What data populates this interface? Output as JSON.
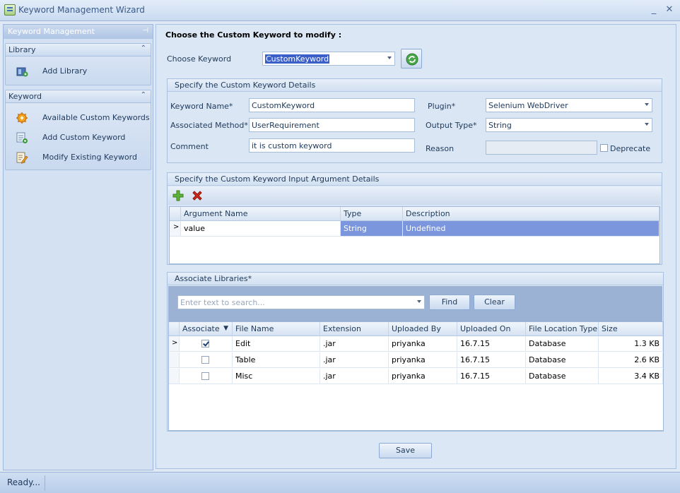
{
  "window": {
    "title": "Keyword Management Wizard",
    "minimize_glyph": "_",
    "close_glyph": "✕"
  },
  "left_pane": {
    "header": "Keyword Management",
    "pin_glyph": "⊣",
    "groups": [
      {
        "title": "Library",
        "items": [
          {
            "label": "Add Library",
            "icon": "add-library-icon"
          }
        ]
      },
      {
        "title": "Keyword",
        "items": [
          {
            "label": "Available Custom Keywords",
            "icon": "gear-icon"
          },
          {
            "label": "Add Custom Keyword",
            "icon": "add-keyword-icon"
          },
          {
            "label": "Modify Existing  Keyword",
            "icon": "edit-icon"
          }
        ]
      }
    ],
    "collapse_glyph": "⌃"
  },
  "main": {
    "heading": "Choose the Custom Keyword to modify  :",
    "choose_keyword_label": "Choose Keyword",
    "choose_keyword_value": "CustomKeyword",
    "details": {
      "title": "Specify the Custom Keyword Details",
      "keyword_name_label": "Keyword Name*",
      "keyword_name_value": "CustomKeyword",
      "associated_method_label": "Associated Method*",
      "associated_method_value": "UserRequirement",
      "comment_label": "Comment",
      "comment_value": "it is custom keyword",
      "plugin_label": "Plugin*",
      "plugin_value": "Selenium WebDriver",
      "output_type_label": "Output Type*",
      "output_type_value": "String",
      "reason_label": "Reason",
      "reason_value": "",
      "deprecate_label": "Deprecate",
      "deprecate_checked": false
    },
    "arguments": {
      "title": "Specify the Custom Keyword Input Argument Details",
      "columns": [
        "Argument Name",
        "Type",
        "Description"
      ],
      "rows": [
        {
          "name": "value",
          "type": "String",
          "description": "Undefined"
        }
      ]
    },
    "libraries": {
      "title": "Associate Libraries*",
      "search_placeholder": "Enter text to search...",
      "find_label": "Find",
      "clear_label": "Clear",
      "columns": [
        "Associate",
        "File Name",
        "Extension",
        "Uploaded By",
        "Uploaded On",
        "File Location Type",
        "Size"
      ],
      "rows": [
        {
          "associate": true,
          "file_name": "Edit",
          "extension": ".jar",
          "uploaded_by": "priyanka",
          "uploaded_on": "16.7.15",
          "location": "Database",
          "size": "1.3 KB"
        },
        {
          "associate": false,
          "file_name": "Table",
          "extension": ".jar",
          "uploaded_by": "priyanka",
          "uploaded_on": "16.7.15",
          "location": "Database",
          "size": "2.6 KB"
        },
        {
          "associate": false,
          "file_name": "Misc",
          "extension": ".jar",
          "uploaded_by": "priyanka",
          "uploaded_on": "16.7.15",
          "location": "Database",
          "size": "3.4 KB"
        }
      ]
    },
    "save_label": "Save"
  },
  "status": {
    "text": "Ready..."
  },
  "colors": {
    "selection": "#7b96dc",
    "accent": "#1e395b"
  }
}
